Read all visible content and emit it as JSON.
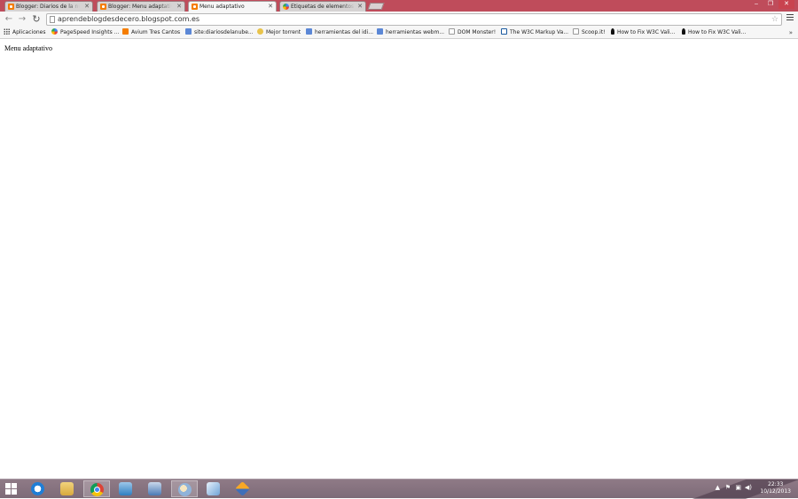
{
  "tabs": [
    {
      "label": "Blogger: Diarios de la nub",
      "icon": "blogger-icon",
      "active": false
    },
    {
      "label": "Blogger: Menu adaptativo",
      "icon": "blogger-icon",
      "active": false
    },
    {
      "label": "Menu adaptativo",
      "icon": "blogger-icon",
      "active": true
    },
    {
      "label": "Etiquetas de elementos de",
      "icon": "multicolor-icon",
      "active": false
    }
  ],
  "address_bar": {
    "url": "aprendeblogdesdecero.blogspot.com.es"
  },
  "bookmarks": [
    {
      "label": "Aplicaciones",
      "icon": "apps"
    },
    {
      "label": "PageSpeed Insights ...",
      "icon": "pagespeed"
    },
    {
      "label": "Avium Tres Cantos",
      "icon": "blogger"
    },
    {
      "label": "site:diariosdelanube...",
      "icon": "google"
    },
    {
      "label": "Mejor torrent",
      "icon": "torrent"
    },
    {
      "label": "herramientas del idi...",
      "icon": "google"
    },
    {
      "label": "herramientas webm...",
      "icon": "google"
    },
    {
      "label": "DOM Monster!",
      "icon": "doc"
    },
    {
      "label": "The W3C Markup Va...",
      "icon": "w3"
    },
    {
      "label": "Scoop.it!",
      "icon": "doc"
    },
    {
      "label": "How to Fix W3C Vali...",
      "icon": "pin"
    },
    {
      "label": "How to Fix W3C Vali...",
      "icon": "pin"
    }
  ],
  "bookmarks_overflow": "»",
  "page": {
    "text": "Menu adaptativo"
  },
  "taskbar": {
    "clock_time": "22:33",
    "clock_date": "10/12/2013"
  }
}
